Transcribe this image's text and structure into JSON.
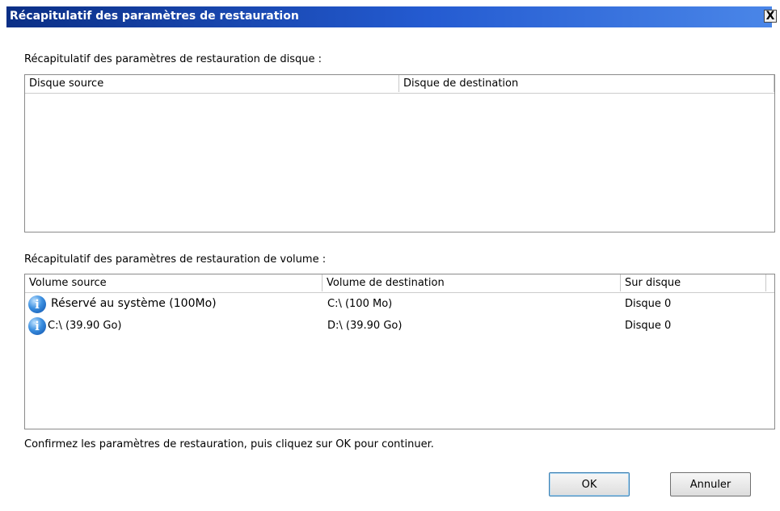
{
  "window": {
    "title": "Récapitulatif des paramètres de restauration",
    "close_glyph": "X"
  },
  "disk_section": {
    "label": "Récapitulatif des paramètres de restauration de disque :",
    "columns": [
      "Disque source",
      "Disque de destination"
    ],
    "rows": []
  },
  "volume_section": {
    "label": "Récapitulatif des paramètres de restauration de volume :",
    "columns": [
      "Volume source",
      "Volume de destination",
      "Sur disque"
    ],
    "rows": [
      {
        "icon": "info-icon",
        "source": "Réservé au système (100Mo)",
        "destination": "C:\\ (100 Mo)",
        "disk": "Disque 0"
      },
      {
        "icon": "info-icon",
        "source": "C:\\ (39.90 Go)",
        "destination": "D:\\ (39.90 Go)",
        "disk": "Disque 0"
      }
    ]
  },
  "footer": {
    "message": "Confirmez les paramètres de restauration, puis cliquez sur OK pour continuer.",
    "ok_label": "OK",
    "cancel_label": "Annuler"
  },
  "colors": {
    "titlebar": "#0b2f86",
    "titlebar_accent": "#4a86e8",
    "info_icon": "#3b8fe0"
  }
}
